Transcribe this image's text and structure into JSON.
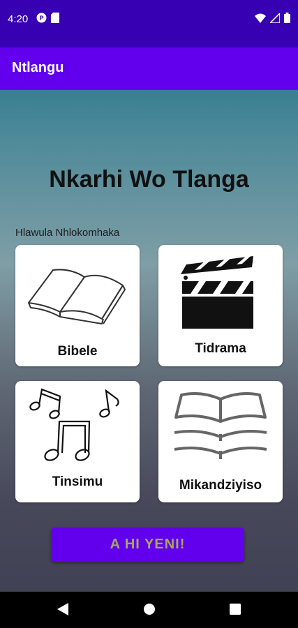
{
  "status_bar": {
    "time": "4:20",
    "left_icons": [
      "notification-p-icon",
      "sd-card-icon"
    ],
    "right_icons": [
      "wifi-icon",
      "signal-icon",
      "battery-icon"
    ]
  },
  "app_bar": {
    "title": "Ntlangu"
  },
  "main": {
    "title": "Nkarhi Wo Tlanga",
    "section_label": "Hlawula Nhlokomhaka",
    "cards": [
      {
        "label": "Bibele",
        "icon": "open-book-icon"
      },
      {
        "label": "Tidrama",
        "icon": "clapperboard-icon"
      },
      {
        "label": "Tinsimu",
        "icon": "music-notes-icon"
      },
      {
        "label": "Mikandziyiso",
        "icon": "stacked-books-icon"
      }
    ],
    "start_button_label": "A HI YENI!"
  },
  "nav_bar": {
    "buttons": [
      "back-icon",
      "home-icon",
      "recents-icon"
    ]
  },
  "colors": {
    "status_bar": "#3700b3",
    "app_bar": "#6200ee",
    "button": "#6200ee"
  }
}
